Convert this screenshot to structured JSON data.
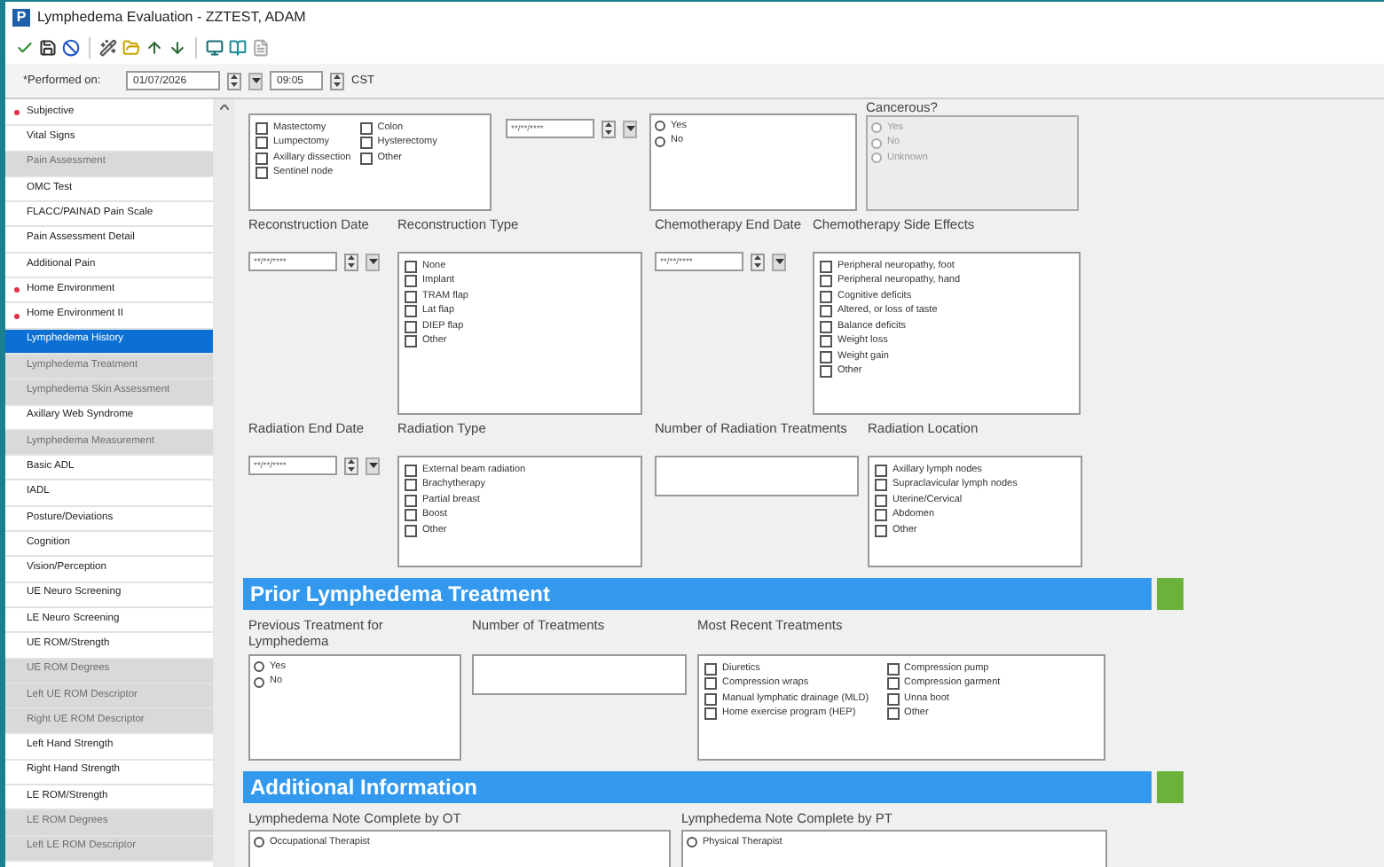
{
  "window": {
    "icon_letter": "P",
    "title": "Lymphedema Evaluation - ZZTEST, ADAM"
  },
  "performed": {
    "label": "*Performed on:",
    "date": "01/07/2026",
    "time": "09:05",
    "zone": "CST"
  },
  "sidebar": {
    "items": [
      {
        "label": "Subjective",
        "required": true,
        "disabled": false,
        "selected": false
      },
      {
        "label": "Vital Signs",
        "required": false,
        "disabled": false,
        "selected": false
      },
      {
        "label": "Pain Assessment",
        "required": false,
        "disabled": true,
        "selected": false
      },
      {
        "label": "OMC Test",
        "required": false,
        "disabled": false,
        "selected": false
      },
      {
        "label": "FLACC/PAINAD Pain Scale",
        "required": false,
        "disabled": false,
        "selected": false
      },
      {
        "label": "Pain Assessment Detail",
        "required": false,
        "disabled": false,
        "selected": false
      },
      {
        "label": "Additional Pain",
        "required": false,
        "disabled": false,
        "selected": false
      },
      {
        "label": "Home Environment",
        "required": true,
        "disabled": false,
        "selected": false
      },
      {
        "label": "Home Environment II",
        "required": true,
        "disabled": false,
        "selected": false
      },
      {
        "label": "Lymphedema History",
        "required": false,
        "disabled": false,
        "selected": true
      },
      {
        "label": "Lymphedema Treatment",
        "required": false,
        "disabled": true,
        "selected": false
      },
      {
        "label": "Lymphedema Skin Assessment",
        "required": false,
        "disabled": true,
        "selected": false
      },
      {
        "label": "Axillary Web Syndrome",
        "required": false,
        "disabled": false,
        "selected": false
      },
      {
        "label": "Lymphedema Measurement",
        "required": false,
        "disabled": true,
        "selected": false
      },
      {
        "label": "Basic ADL",
        "required": false,
        "disabled": false,
        "selected": false
      },
      {
        "label": "IADL",
        "required": false,
        "disabled": false,
        "selected": false
      },
      {
        "label": "Posture/Deviations",
        "required": false,
        "disabled": false,
        "selected": false
      },
      {
        "label": "Cognition",
        "required": false,
        "disabled": false,
        "selected": false
      },
      {
        "label": "Vision/Perception",
        "required": false,
        "disabled": false,
        "selected": false
      },
      {
        "label": "UE Neuro Screening",
        "required": false,
        "disabled": false,
        "selected": false
      },
      {
        "label": "LE Neuro Screening",
        "required": false,
        "disabled": false,
        "selected": false
      },
      {
        "label": "UE ROM/Strength",
        "required": false,
        "disabled": false,
        "selected": false
      },
      {
        "label": "UE ROM Degrees",
        "required": false,
        "disabled": true,
        "selected": false
      },
      {
        "label": "Left UE ROM Descriptor",
        "required": false,
        "disabled": true,
        "selected": false
      },
      {
        "label": "Right UE ROM Descriptor",
        "required": false,
        "disabled": true,
        "selected": false
      },
      {
        "label": "Left Hand Strength",
        "required": false,
        "disabled": false,
        "selected": false
      },
      {
        "label": "Right Hand Strength",
        "required": false,
        "disabled": false,
        "selected": false
      },
      {
        "label": "LE ROM/Strength",
        "required": false,
        "disabled": false,
        "selected": false
      },
      {
        "label": "LE ROM Degrees",
        "required": false,
        "disabled": true,
        "selected": false
      },
      {
        "label": "Left LE ROM Descriptor",
        "required": false,
        "disabled": true,
        "selected": false
      }
    ]
  },
  "top_row": {
    "procedures": [
      {
        "label": "Mastectomy",
        "checked": false
      },
      {
        "label": "Lumpectomy",
        "checked": false
      },
      {
        "label": "Axillary dissection",
        "checked": false
      },
      {
        "label": "Sentinel node",
        "checked": false
      },
      {
        "label": "Colon",
        "checked": false
      },
      {
        "label": "Hysterectomy",
        "checked": false
      },
      {
        "label": "Other",
        "checked": false
      }
    ],
    "date_placeholder": "**/**/****",
    "yes_no": [
      {
        "label": "Yes",
        "selected": false
      },
      {
        "label": "No",
        "selected": false
      }
    ],
    "cancerous": {
      "label": "Cancerous?",
      "disabled": true,
      "options": [
        {
          "label": "Yes",
          "selected": false
        },
        {
          "label": "No",
          "selected": false
        },
        {
          "label": "Unknown",
          "selected": false
        }
      ]
    }
  },
  "field_rows": [
    [
      {
        "kind": "date",
        "label": "Reconstruction Date",
        "placeholder": "**/**/****"
      },
      {
        "kind": "checklist",
        "label": "Reconstruction Type",
        "options": [
          {
            "label": "None",
            "checked": false
          },
          {
            "label": "Implant",
            "checked": false
          },
          {
            "label": "TRAM flap",
            "checked": false
          },
          {
            "label": "Lat flap",
            "checked": false
          },
          {
            "label": "DIEP flap",
            "checked": false
          },
          {
            "label": "Other",
            "checked": false
          }
        ]
      },
      {
        "kind": "date",
        "label": "Chemotherapy End Date",
        "placeholder": "**/**/****"
      },
      {
        "kind": "checklist",
        "label": "Chemotherapy Side Effects",
        "options": [
          {
            "label": "Peripheral neuropathy, foot",
            "checked": false
          },
          {
            "label": "Peripheral neuropathy, hand",
            "checked": false
          },
          {
            "label": "Cognitive deficits",
            "checked": false
          },
          {
            "label": "Altered, or loss of taste",
            "checked": false
          },
          {
            "label": "Balance deficits",
            "checked": false
          },
          {
            "label": "Weight loss",
            "checked": false
          },
          {
            "label": "Weight gain",
            "checked": false
          },
          {
            "label": "Other",
            "checked": false
          }
        ]
      }
    ],
    [
      {
        "kind": "date",
        "label": "Radiation End Date",
        "placeholder": "**/**/****"
      },
      {
        "kind": "checklist",
        "label": "Radiation Type",
        "options": [
          {
            "label": "External beam radiation",
            "checked": false
          },
          {
            "label": "Brachytherapy",
            "checked": false
          },
          {
            "label": "Partial breast",
            "checked": false
          },
          {
            "label": "Boost",
            "checked": false
          },
          {
            "label": "Other",
            "checked": false
          }
        ]
      },
      {
        "kind": "text",
        "label": "Number of Radiation Treatments"
      },
      {
        "kind": "checklist",
        "label": "Radiation Location",
        "options": [
          {
            "label": "Axillary lymph nodes",
            "checked": false
          },
          {
            "label": "Supraclavicular lymph nodes",
            "checked": false
          },
          {
            "label": "Uterine/Cervical",
            "checked": false
          },
          {
            "label": "Abdomen",
            "checked": false
          },
          {
            "label": "Other",
            "checked": false
          }
        ]
      }
    ]
  ],
  "sections": [
    {
      "title": "Prior Lymphedema Treatment",
      "fields": [
        {
          "kind": "radios",
          "label": "Previous Treatment for Lymphedema",
          "options": [
            {
              "label": "Yes",
              "selected": false
            },
            {
              "label": "No",
              "selected": false
            }
          ]
        },
        {
          "kind": "text",
          "label": "Number of Treatments"
        },
        {
          "kind": "checklist",
          "label": "Most Recent Treatments",
          "options": [
            {
              "label": "Diuretics",
              "checked": false
            },
            {
              "label": "Compression wraps",
              "checked": false
            },
            {
              "label": "Manual lymphatic drainage (MLD)",
              "checked": false
            },
            {
              "label": "Home exercise program (HEP)",
              "checked": false
            },
            {
              "label": "Compression pump",
              "checked": false
            },
            {
              "label": "Compression garment",
              "checked": false
            },
            {
              "label": "Unna boot",
              "checked": false
            },
            {
              "label": "Other",
              "checked": false
            }
          ]
        }
      ]
    },
    {
      "title": "Additional Information",
      "fields": [
        {
          "kind": "radios",
          "label": "Lymphedema Note Complete by OT",
          "options": [
            {
              "label": "Occupational Therapist",
              "selected": false
            }
          ]
        },
        {
          "kind": "radios",
          "label": "Lymphedema Note Complete by PT",
          "options": [
            {
              "label": "Physical Therapist",
              "selected": false
            }
          ]
        }
      ]
    }
  ]
}
